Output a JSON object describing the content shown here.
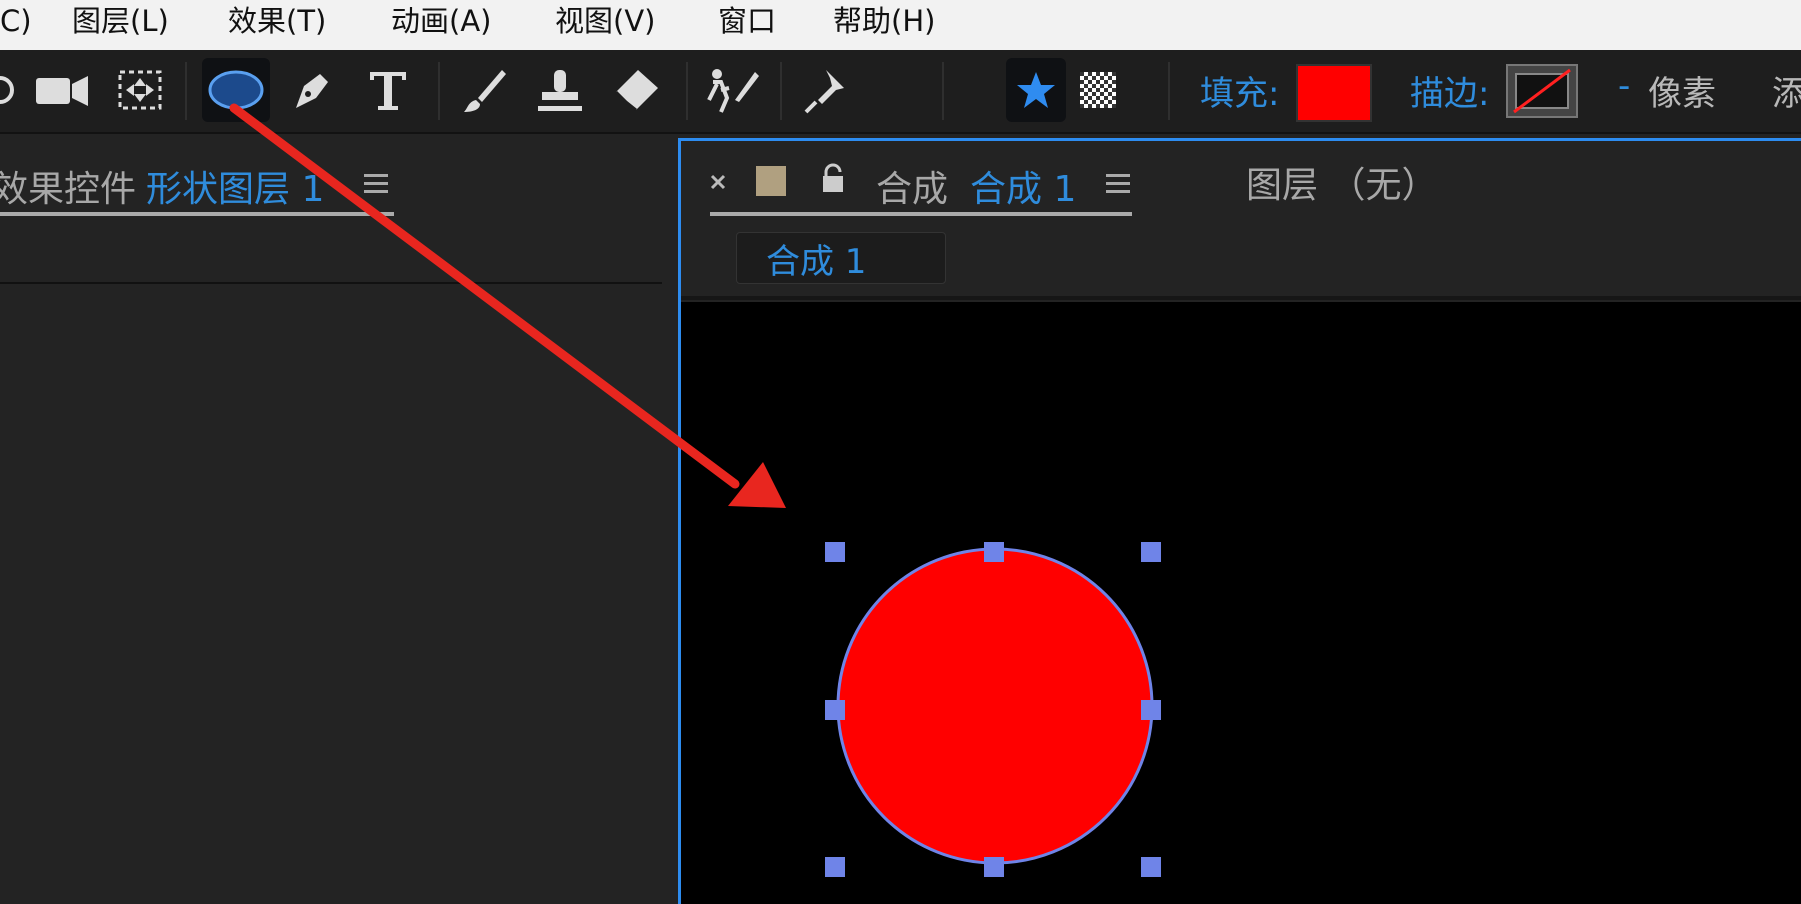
{
  "menu": {
    "items": [
      "C)",
      "图层(L)",
      "效果(T)",
      "动画(A)",
      "视图(V)",
      "窗口",
      "帮助(H)"
    ]
  },
  "toolbar": {
    "tools": [
      "orbit-icon",
      "camera-icon",
      "pan-behind-icon",
      "ellipse-tool-icon",
      "pen-tool-icon",
      "type-tool-icon",
      "brush-tool-icon",
      "clone-stamp-icon",
      "eraser-icon",
      "roto-brush-icon",
      "puppet-pin-icon"
    ],
    "fill_label": "填充:",
    "stroke_label": "描边:",
    "stroke_width": "-",
    "pixel_label": "像素",
    "add_label": "添",
    "fill_color": "#ff0000"
  },
  "left_panel": {
    "tab_prefix": "效果控件",
    "tab_layer": "形状图层 1"
  },
  "comp_panel": {
    "tab_prefix": "合成",
    "tab_name": "合成 1",
    "layer_tab": "图层 （无）",
    "breadcrumb": "合成 1"
  },
  "colors": {
    "accent": "#2d8cf0",
    "shape_fill": "#ff0000",
    "handle": "#6f84e8",
    "arrow": "#e8261f"
  }
}
